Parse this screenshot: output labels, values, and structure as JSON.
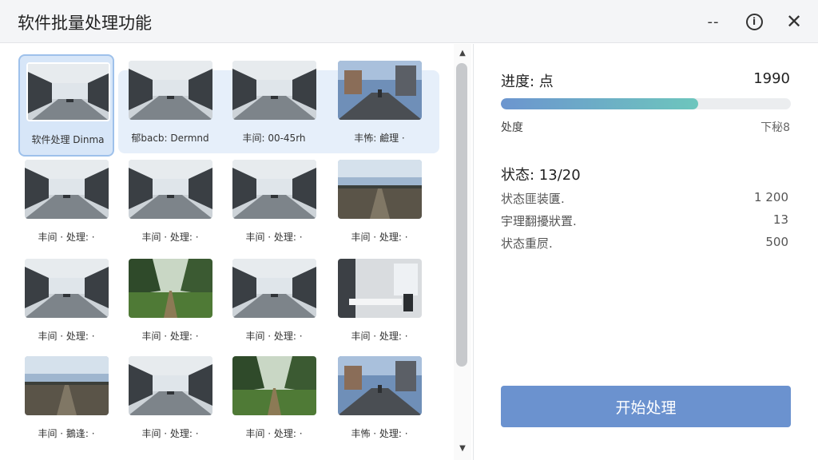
{
  "window": {
    "title": "软件批量处理功能",
    "minimize_label": "--",
    "info_label": "i",
    "close_label": "✕"
  },
  "gallery": {
    "selected_index": 0,
    "tiles": [
      {
        "caption": "软件处理 Dinma",
        "scene": "hall"
      },
      {
        "caption": "郁bacb: Dermnd",
        "scene": "hall"
      },
      {
        "caption": "丰间: 00-45rh",
        "scene": "hall"
      },
      {
        "caption": "丰怖: 鹼理 ·",
        "scene": "street"
      },
      {
        "caption": "丰间 · 处理: ·",
        "scene": "hall"
      },
      {
        "caption": "丰间 · 处理: ·",
        "scene": "hall"
      },
      {
        "caption": "丰间 · 处理: ·",
        "scene": "hall"
      },
      {
        "caption": "丰间 · 处理: ·",
        "scene": "field"
      },
      {
        "caption": "丰间 · 处理: ·",
        "scene": "hall"
      },
      {
        "caption": "丰间 · 处理: ·",
        "scene": "forest"
      },
      {
        "caption": "丰间 · 处理: ·",
        "scene": "hall"
      },
      {
        "caption": "丰间 · 处理: ·",
        "scene": "office"
      },
      {
        "caption": "丰间 · 鵝逢: ·",
        "scene": "field"
      },
      {
        "caption": "丰间 · 处理: ·",
        "scene": "hall"
      },
      {
        "caption": "丰间 · 处理: ·",
        "scene": "forest"
      },
      {
        "caption": "丰怖 · 处理: ·",
        "scene": "street"
      }
    ]
  },
  "progress": {
    "label": "进度: 点",
    "value": "1990",
    "fraction": 0.68,
    "sub_label": "处度",
    "sub_value": "下秘8"
  },
  "status": {
    "label": "状态: 13/20",
    "items": [
      {
        "label": "状态匪装匱.",
        "value": "1 200"
      },
      {
        "label": "宇理翻擾狀置.",
        "value": "13"
      },
      {
        "label": "状态重屃.",
        "value": "500"
      }
    ]
  },
  "actions": {
    "start_label": "开始处理"
  },
  "colors": {
    "accent": "#6b92cf",
    "progress_start": "#6c95cf",
    "progress_end": "#6dc6bd",
    "selection": "#d7e6f8"
  }
}
